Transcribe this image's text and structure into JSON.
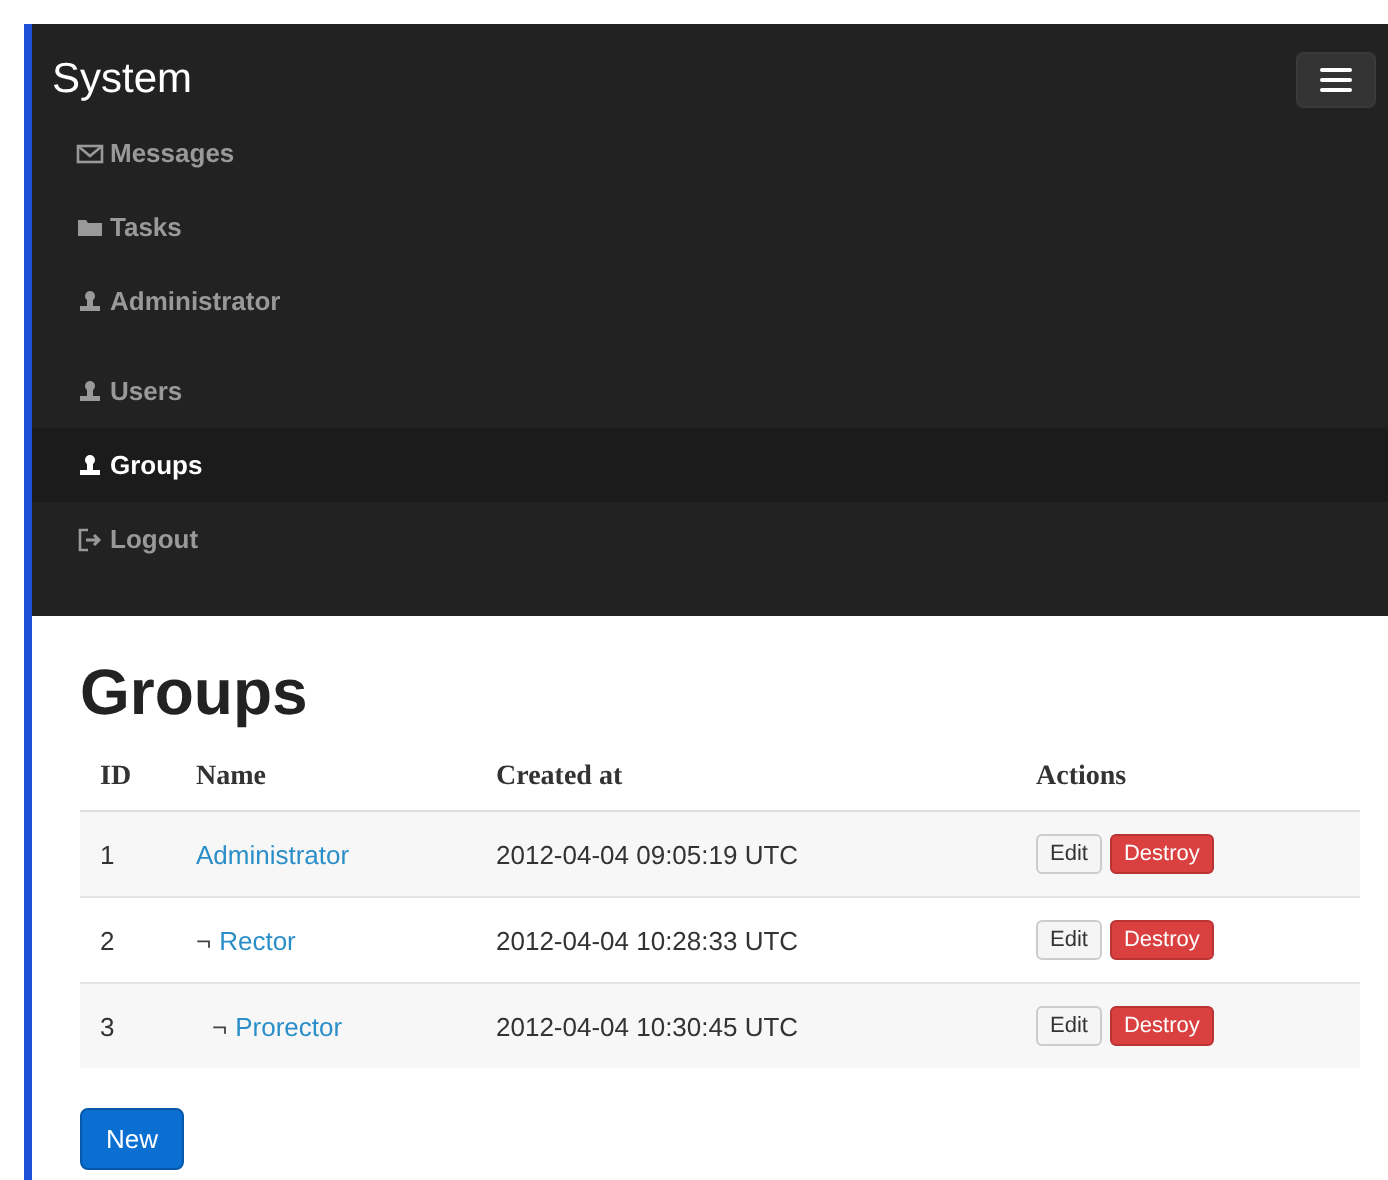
{
  "navbar": {
    "brand": "System",
    "items": [
      {
        "label": "Messages",
        "selected": false,
        "kind": "link"
      },
      {
        "label": "Tasks",
        "selected": false,
        "kind": "link"
      },
      {
        "label": "Administrator",
        "selected": false,
        "kind": "header"
      },
      {
        "label": "Users",
        "selected": false,
        "kind": "link"
      },
      {
        "label": "Groups",
        "selected": true,
        "kind": "link"
      },
      {
        "label": "Logout",
        "selected": false,
        "kind": "link"
      }
    ]
  },
  "page": {
    "title": "Groups",
    "table": {
      "columns": [
        "ID",
        "Name",
        "Created at",
        "Actions"
      ],
      "rows": [
        {
          "id": "1",
          "name": "Administrator",
          "created_at": "2012-04-04 09:05:19 UTC",
          "actions": [
            "Edit",
            "Destroy"
          ],
          "children": [
            {
              "id": "2",
              "marker": "¬",
              "name": "Rector",
              "created_at": "2012-04-04 10:28:33 UTC",
              "actions": [
                "Edit",
                "Destroy"
              ],
              "children": [
                {
                  "id": "3",
                  "marker": "¬",
                  "name": "Prorector",
                  "created_at": "2012-04-04 10:30:45 UTC",
                  "actions": [
                    "Edit",
                    "Destroy"
                  ]
                }
              ]
            }
          ]
        }
      ]
    },
    "new_button": "New"
  }
}
